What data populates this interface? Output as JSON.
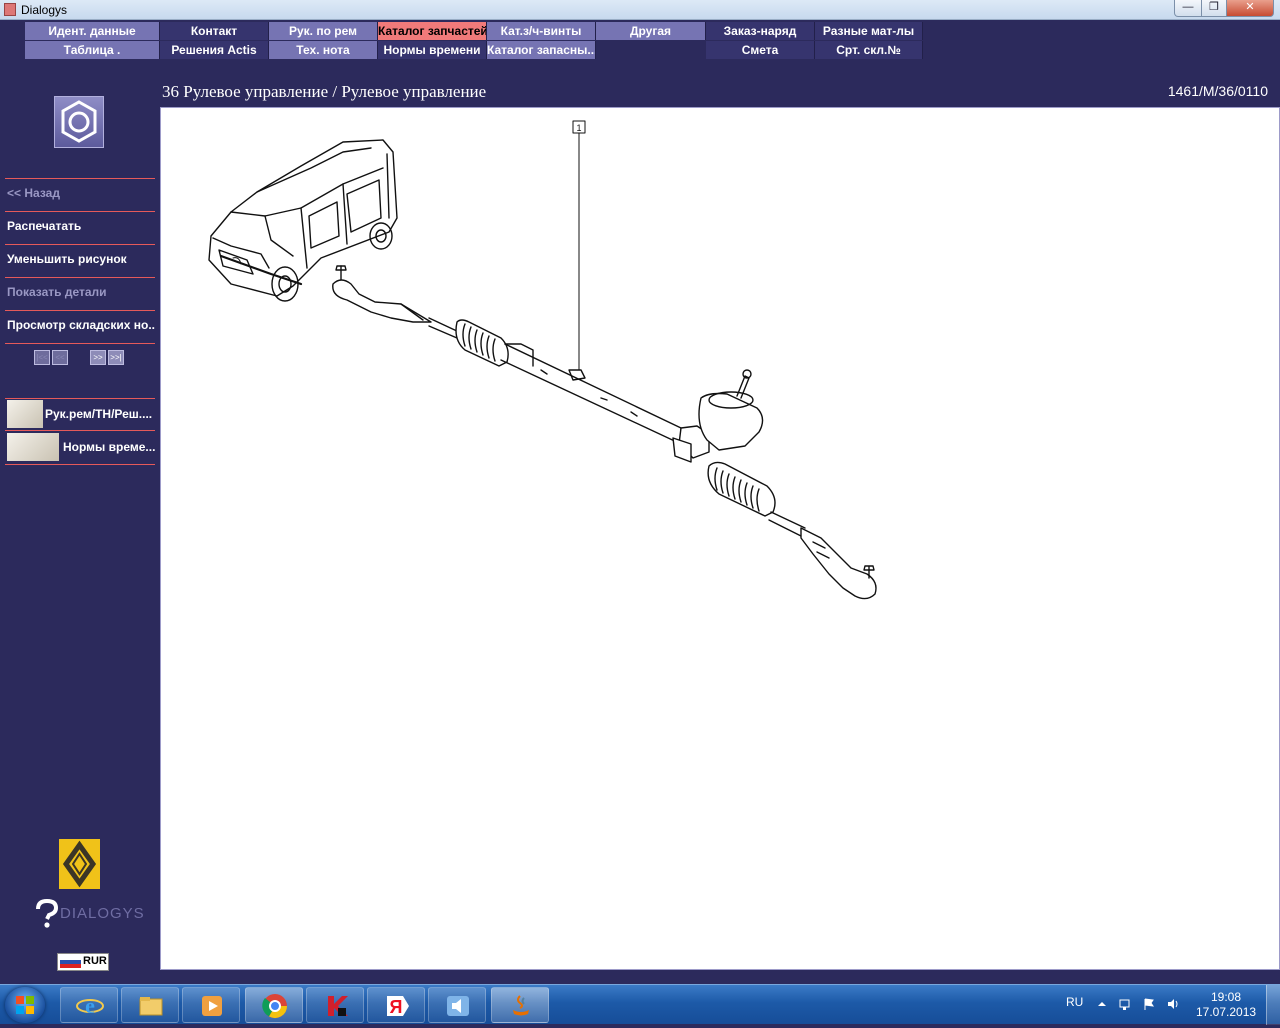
{
  "window": {
    "title": "Dialogys",
    "minimize_icon": "minimize-icon",
    "maximize_icon": "restore-icon",
    "close_icon": "close-icon"
  },
  "menu": {
    "row1": [
      {
        "label": "Идент. данные",
        "style": "light"
      },
      {
        "label": "Контакт",
        "style": "dark"
      },
      {
        "label": "Рук. по рем",
        "style": "light"
      },
      {
        "label": "Каталог запчастей",
        "style": "active"
      },
      {
        "label": "Кат.з/ч-винты",
        "style": "light"
      },
      {
        "label": "Другая",
        "style": "light"
      },
      {
        "label": "Заказ-наряд",
        "style": "dark"
      },
      {
        "label": "Разные мат-лы",
        "style": "dark"
      }
    ],
    "row2": [
      {
        "label": "Таблица .",
        "style": "light"
      },
      {
        "label": "Решения Actis",
        "style": "dark"
      },
      {
        "label": "Тех. нота",
        "style": "light"
      },
      {
        "label": "Нормы времени",
        "style": "dark"
      },
      {
        "label": "Каталог запасны...",
        "style": "light"
      },
      {
        "label": "",
        "style": "none"
      },
      {
        "label": "Смета",
        "style": "dark"
      },
      {
        "label": "Срт. скл.№",
        "style": "dark"
      }
    ]
  },
  "header": {
    "breadcrumb": "36 Рулевое управление / Рулевое управление",
    "doc_code": "1461/M/36/0110"
  },
  "sidebar": {
    "logo_icon": "hex-nut-icon",
    "items": [
      {
        "label": "<< Назад",
        "enabled": false
      },
      {
        "label": "Распечатать",
        "enabled": true
      },
      {
        "label": "Уменьшить рисунок",
        "enabled": true
      },
      {
        "label": "Показать детали",
        "enabled": false
      },
      {
        "label": "Просмотр складских но...",
        "enabled": true
      }
    ],
    "pager": [
      {
        "label": "|<<",
        "enabled": false
      },
      {
        "label": "<<",
        "enabled": false
      },
      {
        "label": ">>",
        "enabled": true
      },
      {
        "label": ">>|",
        "enabled": true
      }
    ],
    "links": [
      {
        "label": "Рук.рем/ТН/Реш...."
      },
      {
        "label": "Нормы време..."
      }
    ],
    "brand_icon": "renault-logo-icon",
    "product_name": "DIALOGYS",
    "currency": "RUR"
  },
  "drawing": {
    "callouts": [
      "1"
    ]
  },
  "taskbar": {
    "apps": [
      {
        "icon": "internet-explorer-icon"
      },
      {
        "icon": "file-explorer-icon"
      },
      {
        "icon": "media-player-icon"
      },
      {
        "icon": "chrome-icon"
      },
      {
        "icon": "kaspersky-icon"
      },
      {
        "icon": "yandex-browser-icon"
      },
      {
        "icon": "sound-app-icon"
      },
      {
        "icon": "java-icon"
      }
    ],
    "language": "RU",
    "time": "19:08",
    "date": "17.07.2013"
  },
  "colors": {
    "background": "#2c2a5c",
    "menu_light": "#7674b3",
    "menu_dark": "#36346e",
    "menu_active": "#f07a7a",
    "separator": "#e65a5a"
  }
}
